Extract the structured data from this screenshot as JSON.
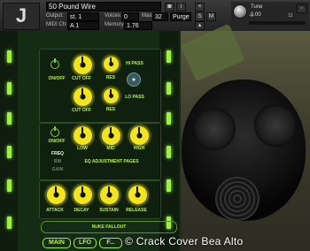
{
  "header": {
    "logo": "J",
    "instrument_name": "50 Pound Wire",
    "output": {
      "label": "Output:",
      "value": "st. 1"
    },
    "midi": {
      "label": "MIDI Ch:",
      "value": "A 1"
    },
    "voices": {
      "label": "Voices:",
      "value": "0",
      "max_label": "Max:",
      "max_value": "32"
    },
    "memory": {
      "label": "Memory:",
      "value": "1.76 MB"
    },
    "purge": "Purge",
    "solo": "S",
    "mute": "M",
    "tune": {
      "label": "Tune",
      "value": "0.00"
    },
    "meter_ticks": [
      "-∞",
      "12"
    ]
  },
  "filter": {
    "on_off": "ON/OFF",
    "cutoff_label": "CUT OFF",
    "res_label": "RES",
    "hi_pass": "HI PASS",
    "lo_pass": "LO PASS"
  },
  "eq": {
    "on_off": "ON/OFF",
    "bands": [
      "LOW",
      "MID",
      "HIGH"
    ],
    "modes": [
      "FREQ",
      "BW",
      "GAIN"
    ],
    "pages_label": "EQ ADJUSTMENT PAGES"
  },
  "envelope": {
    "labels": [
      "ATTACK",
      "DECAY",
      "SUSTAIN",
      "RELEASE"
    ]
  },
  "fallout_button": "NUKE FALLOUT",
  "tabs": [
    "MAIN",
    "LFO",
    "F..."
  ],
  "watermark": "© Crack Cover Bea Alto",
  "colors": {
    "accent": "#b8f040",
    "knob": "#f2e51a",
    "panel": "#142b14"
  }
}
